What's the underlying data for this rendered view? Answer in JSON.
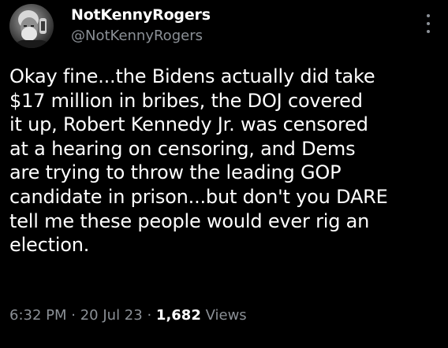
{
  "tweet": {
    "display_name": "NotKennyRogers",
    "handle": "@NotKennyRogers",
    "more_icon": "more-vertical-icon",
    "body_lines": [
      "Okay fine...the Bidens actually did take",
      "$17 million in bribes, the DOJ covered",
      "it up, Robert Kennedy Jr. was censored",
      "at a hearing on censoring, and Dems",
      "are trying to throw the leading GOP",
      "candidate in prison...but don't you DARE",
      "tell me these people would ever rig an",
      "election."
    ],
    "time": "6:32 PM",
    "separator": "·",
    "date": "20 Jul 23",
    "views_count": "1,682",
    "views_label": "Views"
  },
  "colors": {
    "background": "#000000",
    "primary_text": "#ffffff",
    "secondary_text": "#8b9096"
  }
}
